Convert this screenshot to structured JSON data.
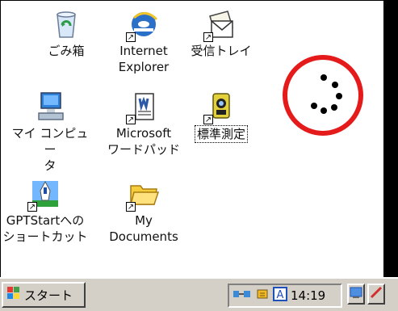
{
  "desktop": {
    "icons": [
      {
        "label": "ごみ箱",
        "icon": "recycle-bin-icon"
      },
      {
        "label": "Internet\nExplorer",
        "icon": "internet-explorer-icon"
      },
      {
        "label": "受信トレイ",
        "icon": "inbox-icon"
      },
      {
        "label": "マイ コンピュー\nタ",
        "icon": "my-computer-icon"
      },
      {
        "label": "Microsoft\nワードパッド",
        "icon": "wordpad-icon"
      },
      {
        "label": "標準測定",
        "icon": "survey-instrument-icon"
      },
      {
        "label": "GPTStartへの\nショートカット",
        "icon": "gptstart-shortcut-icon"
      },
      {
        "label": "My\nDocuments",
        "icon": "my-documents-folder-icon"
      }
    ]
  },
  "busy_indicator": {
    "icon": "loading-spinner-icon"
  },
  "taskbar": {
    "start_label": "スタート",
    "clock": "14:19",
    "tray_icons": [
      "network-icon",
      "input-method-icon",
      "keyboard-a-icon",
      "desktop-icon",
      "pen-icon"
    ]
  }
}
